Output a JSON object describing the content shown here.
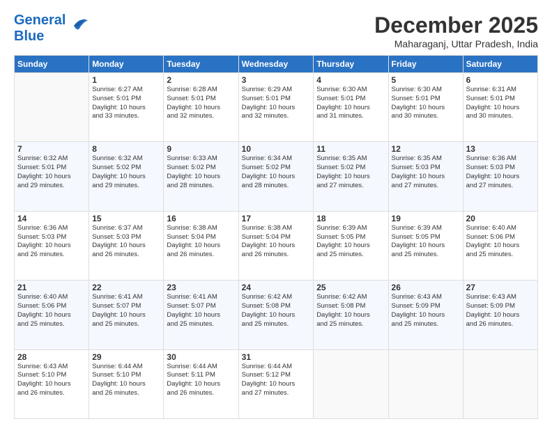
{
  "logo": {
    "part1": "General",
    "part2": "Blue"
  },
  "header": {
    "month": "December 2025",
    "location": "Maharaganj, Uttar Pradesh, India"
  },
  "weekdays": [
    "Sunday",
    "Monday",
    "Tuesday",
    "Wednesday",
    "Thursday",
    "Friday",
    "Saturday"
  ],
  "weeks": [
    [
      {
        "day": "",
        "info": ""
      },
      {
        "day": "1",
        "info": "Sunrise: 6:27 AM\nSunset: 5:01 PM\nDaylight: 10 hours\nand 33 minutes."
      },
      {
        "day": "2",
        "info": "Sunrise: 6:28 AM\nSunset: 5:01 PM\nDaylight: 10 hours\nand 32 minutes."
      },
      {
        "day": "3",
        "info": "Sunrise: 6:29 AM\nSunset: 5:01 PM\nDaylight: 10 hours\nand 32 minutes."
      },
      {
        "day": "4",
        "info": "Sunrise: 6:30 AM\nSunset: 5:01 PM\nDaylight: 10 hours\nand 31 minutes."
      },
      {
        "day": "5",
        "info": "Sunrise: 6:30 AM\nSunset: 5:01 PM\nDaylight: 10 hours\nand 30 minutes."
      },
      {
        "day": "6",
        "info": "Sunrise: 6:31 AM\nSunset: 5:01 PM\nDaylight: 10 hours\nand 30 minutes."
      }
    ],
    [
      {
        "day": "7",
        "info": "Sunrise: 6:32 AM\nSunset: 5:01 PM\nDaylight: 10 hours\nand 29 minutes."
      },
      {
        "day": "8",
        "info": "Sunrise: 6:32 AM\nSunset: 5:02 PM\nDaylight: 10 hours\nand 29 minutes."
      },
      {
        "day": "9",
        "info": "Sunrise: 6:33 AM\nSunset: 5:02 PM\nDaylight: 10 hours\nand 28 minutes."
      },
      {
        "day": "10",
        "info": "Sunrise: 6:34 AM\nSunset: 5:02 PM\nDaylight: 10 hours\nand 28 minutes."
      },
      {
        "day": "11",
        "info": "Sunrise: 6:35 AM\nSunset: 5:02 PM\nDaylight: 10 hours\nand 27 minutes."
      },
      {
        "day": "12",
        "info": "Sunrise: 6:35 AM\nSunset: 5:03 PM\nDaylight: 10 hours\nand 27 minutes."
      },
      {
        "day": "13",
        "info": "Sunrise: 6:36 AM\nSunset: 5:03 PM\nDaylight: 10 hours\nand 27 minutes."
      }
    ],
    [
      {
        "day": "14",
        "info": "Sunrise: 6:36 AM\nSunset: 5:03 PM\nDaylight: 10 hours\nand 26 minutes."
      },
      {
        "day": "15",
        "info": "Sunrise: 6:37 AM\nSunset: 5:03 PM\nDaylight: 10 hours\nand 26 minutes."
      },
      {
        "day": "16",
        "info": "Sunrise: 6:38 AM\nSunset: 5:04 PM\nDaylight: 10 hours\nand 26 minutes."
      },
      {
        "day": "17",
        "info": "Sunrise: 6:38 AM\nSunset: 5:04 PM\nDaylight: 10 hours\nand 26 minutes."
      },
      {
        "day": "18",
        "info": "Sunrise: 6:39 AM\nSunset: 5:05 PM\nDaylight: 10 hours\nand 25 minutes."
      },
      {
        "day": "19",
        "info": "Sunrise: 6:39 AM\nSunset: 5:05 PM\nDaylight: 10 hours\nand 25 minutes."
      },
      {
        "day": "20",
        "info": "Sunrise: 6:40 AM\nSunset: 5:06 PM\nDaylight: 10 hours\nand 25 minutes."
      }
    ],
    [
      {
        "day": "21",
        "info": "Sunrise: 6:40 AM\nSunset: 5:06 PM\nDaylight: 10 hours\nand 25 minutes."
      },
      {
        "day": "22",
        "info": "Sunrise: 6:41 AM\nSunset: 5:07 PM\nDaylight: 10 hours\nand 25 minutes."
      },
      {
        "day": "23",
        "info": "Sunrise: 6:41 AM\nSunset: 5:07 PM\nDaylight: 10 hours\nand 25 minutes."
      },
      {
        "day": "24",
        "info": "Sunrise: 6:42 AM\nSunset: 5:08 PM\nDaylight: 10 hours\nand 25 minutes."
      },
      {
        "day": "25",
        "info": "Sunrise: 6:42 AM\nSunset: 5:08 PM\nDaylight: 10 hours\nand 25 minutes."
      },
      {
        "day": "26",
        "info": "Sunrise: 6:43 AM\nSunset: 5:09 PM\nDaylight: 10 hours\nand 25 minutes."
      },
      {
        "day": "27",
        "info": "Sunrise: 6:43 AM\nSunset: 5:09 PM\nDaylight: 10 hours\nand 26 minutes."
      }
    ],
    [
      {
        "day": "28",
        "info": "Sunrise: 6:43 AM\nSunset: 5:10 PM\nDaylight: 10 hours\nand 26 minutes."
      },
      {
        "day": "29",
        "info": "Sunrise: 6:44 AM\nSunset: 5:10 PM\nDaylight: 10 hours\nand 26 minutes."
      },
      {
        "day": "30",
        "info": "Sunrise: 6:44 AM\nSunset: 5:11 PM\nDaylight: 10 hours\nand 26 minutes."
      },
      {
        "day": "31",
        "info": "Sunrise: 6:44 AM\nSunset: 5:12 PM\nDaylight: 10 hours\nand 27 minutes."
      },
      {
        "day": "",
        "info": ""
      },
      {
        "day": "",
        "info": ""
      },
      {
        "day": "",
        "info": ""
      }
    ]
  ]
}
